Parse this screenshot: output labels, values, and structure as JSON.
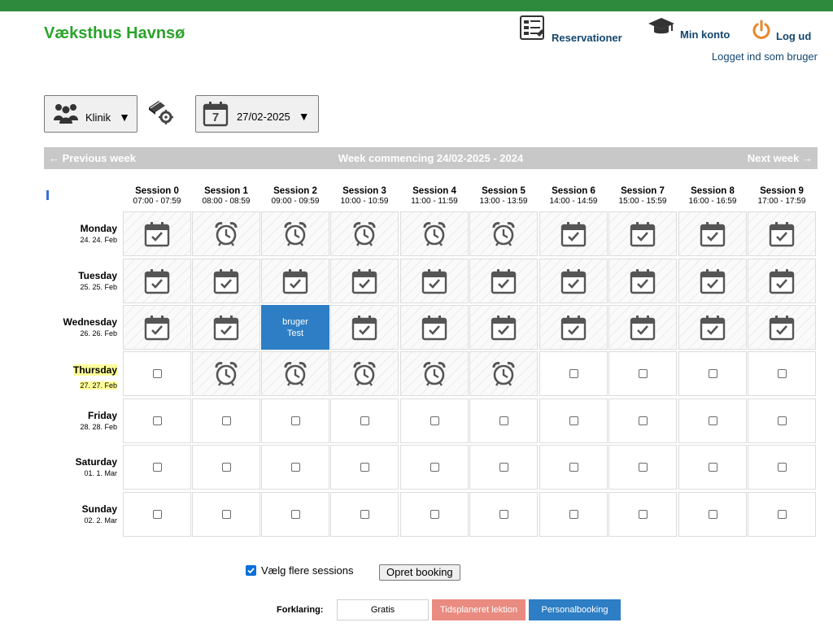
{
  "app": {
    "brand": "Væksthus Havnsø",
    "logged_in_as": "Logget ind som bruger"
  },
  "nav": {
    "reservations": "Reservationer",
    "account": "Min konto",
    "logout": "Log ud"
  },
  "filters": {
    "location": "Klinik",
    "date": "27/02-2025",
    "calendar_day": "7",
    "arrow": "▼"
  },
  "week": {
    "prev": "← Previous week",
    "title": "Week commencing 24/02-2025 - 2024",
    "next": "Next week →"
  },
  "sessions": [
    {
      "name": "Session 0",
      "time": "07:00 - 07:59"
    },
    {
      "name": "Session 1",
      "time": "08:00 - 08:59"
    },
    {
      "name": "Session 2",
      "time": "09:00 - 09:59"
    },
    {
      "name": "Session 3",
      "time": "10:00 - 10:59"
    },
    {
      "name": "Session 4",
      "time": "11:00 - 11:59"
    },
    {
      "name": "Session 5",
      "time": "13:00 - 13:59"
    },
    {
      "name": "Session 6",
      "time": "14:00 - 14:59"
    },
    {
      "name": "Session 7",
      "time": "15:00 - 15:59"
    },
    {
      "name": "Session 8",
      "time": "16:00 - 16:59"
    },
    {
      "name": "Session 9",
      "time": "17:00 - 17:59"
    }
  ],
  "days": [
    {
      "name": "Monday",
      "date": "24. 24. Feb",
      "today": false,
      "cells": [
        "cal",
        "clock",
        "clock",
        "clock",
        "clock",
        "clock",
        "cal",
        "cal",
        "cal",
        "cal"
      ]
    },
    {
      "name": "Tuesday",
      "date": "25. 25. Feb",
      "today": false,
      "cells": [
        "cal",
        "cal",
        "cal",
        "cal",
        "cal",
        "cal",
        "cal",
        "cal",
        "cal",
        "cal"
      ]
    },
    {
      "name": "Wednesday",
      "date": "26. 26. Feb",
      "today": false,
      "cells": [
        "cal",
        "cal",
        "booked",
        "cal",
        "cal",
        "cal",
        "cal",
        "cal",
        "cal",
        "cal"
      ]
    },
    {
      "name": "Thursday",
      "date": "27. 27. Feb",
      "today": true,
      "cells": [
        "box",
        "clock",
        "clock",
        "clock",
        "clock",
        "clock",
        "box",
        "box",
        "box",
        "box"
      ]
    },
    {
      "name": "Friday",
      "date": "28. 28. Feb",
      "today": false,
      "cells": [
        "box",
        "box",
        "box",
        "box",
        "box",
        "box",
        "box",
        "box",
        "box",
        "box"
      ]
    },
    {
      "name": "Saturday",
      "date": "01. 1. Mar",
      "today": false,
      "cells": [
        "box",
        "box",
        "box",
        "box",
        "box",
        "box",
        "box",
        "box",
        "box",
        "box"
      ]
    },
    {
      "name": "Sunday",
      "date": "02. 2. Mar",
      "today": false,
      "cells": [
        "box",
        "box",
        "box",
        "box",
        "box",
        "box",
        "box",
        "box",
        "box",
        "box"
      ]
    }
  ],
  "booking": {
    "line1": "bruger",
    "line2": "Test"
  },
  "actions": {
    "multi_label": "Vælg flere sessions",
    "multi_checked": true,
    "create": "Opret booking"
  },
  "legend": {
    "label": "Forklaring:",
    "items": [
      {
        "label": "Gratis",
        "bg": "#ffffff",
        "fg": "#000000"
      },
      {
        "label": "Tidsplaneret lektion",
        "bg": "#e98b80",
        "fg": "#ffffff"
      },
      {
        "label": "Personalbooking",
        "bg": "#2d7ec5",
        "fg": "#ffffff"
      }
    ]
  },
  "colors": {
    "topbar": "#2e8b3e",
    "brand": "#2aa32a",
    "nav": "#14466e",
    "booked": "#2d7ec5",
    "logout_icon": "#e8872a"
  }
}
